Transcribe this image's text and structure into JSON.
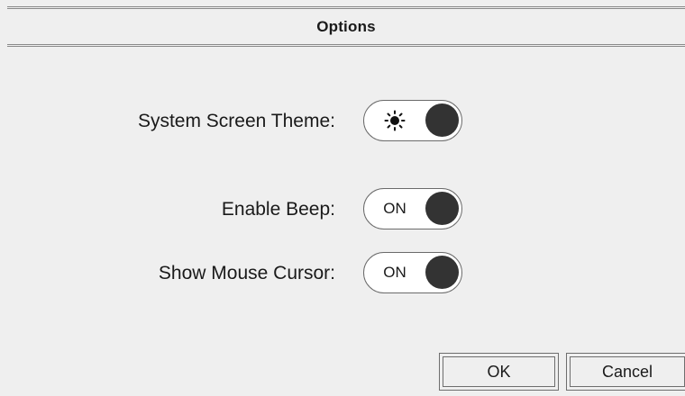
{
  "dialog": {
    "title": "Options"
  },
  "options": [
    {
      "label": "System Screen Theme:",
      "control": "toggle",
      "toggle_icon": "sun-icon",
      "toggle_text": "",
      "state": "on"
    },
    {
      "label": "Enable Beep:",
      "control": "toggle",
      "toggle_text": "ON",
      "state": "on"
    },
    {
      "label": "Show Mouse Cursor:",
      "control": "toggle",
      "toggle_text": "ON",
      "state": "on"
    }
  ],
  "buttons": {
    "ok_label": "OK",
    "cancel_label": "Cancel"
  },
  "colors": {
    "background": "#efefef",
    "knob": "#333333",
    "toggle_bg": "#ffffff",
    "border": "#6e6e6e"
  }
}
